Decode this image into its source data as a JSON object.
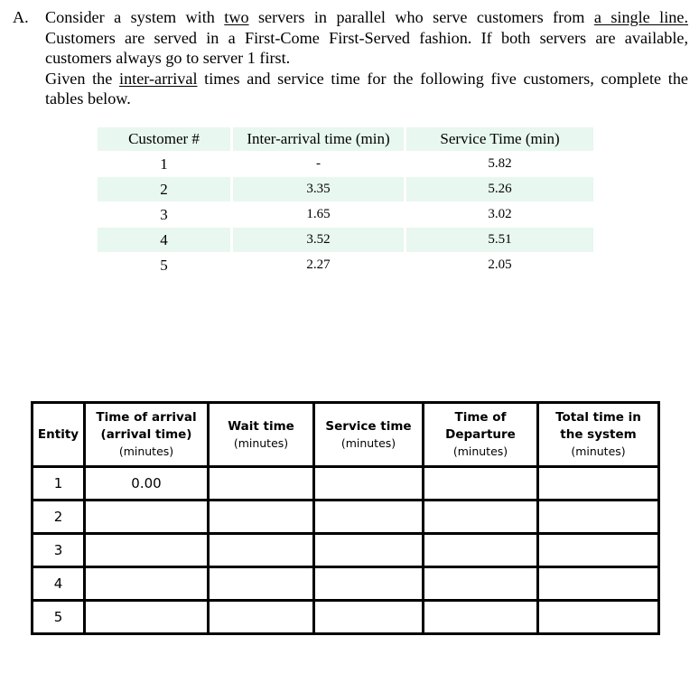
{
  "problem": {
    "label": "A.",
    "line1_parts": [
      "Consider a system with ",
      "two",
      " servers in parallel who serve customers from ",
      "a single line."
    ],
    "line2": "Customers are served in a First-Come First-Served fashion. If both servers are available,",
    "line3": "customers always go to server 1 first.",
    "line4_parts": [
      "Given the ",
      "inter-arrival",
      " times and service time for the following five customers, complete the"
    ],
    "line5": "tables below."
  },
  "given_table": {
    "headers": [
      "Customer #",
      "Inter-arrival time (min)",
      "Service Time (min)"
    ],
    "rows": [
      {
        "customer": "1",
        "inter_arrival": "-",
        "service": "5.82"
      },
      {
        "customer": "2",
        "inter_arrival": "3.35",
        "service": "5.26"
      },
      {
        "customer": "3",
        "inter_arrival": "1.65",
        "service": "3.02"
      },
      {
        "customer": "4",
        "inter_arrival": "3.52",
        "service": "5.51"
      },
      {
        "customer": "5",
        "inter_arrival": "2.27",
        "service": "2.05"
      }
    ],
    "shade_color": "#e8f7f0"
  },
  "answer_table": {
    "headers": [
      {
        "title_lines": [
          "Entity"
        ],
        "unit": ""
      },
      {
        "title_lines": [
          "Time of arrival",
          "(arrival time)"
        ],
        "unit": "(minutes)"
      },
      {
        "title_lines": [
          "Wait time"
        ],
        "unit": "(minutes)"
      },
      {
        "title_lines": [
          "Service time"
        ],
        "unit": "(minutes)"
      },
      {
        "title_lines": [
          "Time of",
          "Departure"
        ],
        "unit": "(minutes)"
      },
      {
        "title_lines": [
          "Total time in",
          "the system"
        ],
        "unit": "(minutes)"
      }
    ],
    "rows": [
      {
        "entity": "1",
        "arrival": "0.00",
        "wait": "",
        "service": "",
        "departure": "",
        "total": ""
      },
      {
        "entity": "2",
        "arrival": "",
        "wait": "",
        "service": "",
        "departure": "",
        "total": ""
      },
      {
        "entity": "3",
        "arrival": "",
        "wait": "",
        "service": "",
        "departure": "",
        "total": ""
      },
      {
        "entity": "4",
        "arrival": "",
        "wait": "",
        "service": "",
        "departure": "",
        "total": ""
      },
      {
        "entity": "5",
        "arrival": "",
        "wait": "",
        "service": "",
        "departure": "",
        "total": ""
      }
    ]
  }
}
